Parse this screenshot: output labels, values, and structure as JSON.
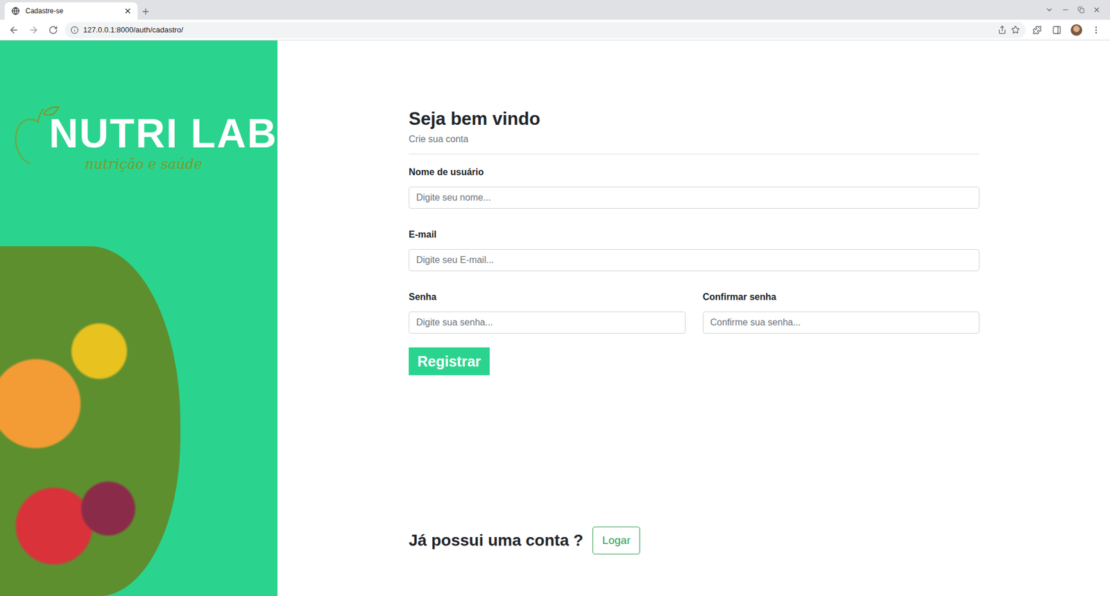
{
  "browser": {
    "tabs": [
      {
        "label": "Cadastre-se",
        "selected": true
      }
    ],
    "url": "127.0.0.1:8000/auth/cadastro/"
  },
  "logo": {
    "title": "NUTRI LAB",
    "tagline": "nutrição e saúde"
  },
  "form": {
    "heading": "Seja bem vindo",
    "subheading": "Crie sua conta",
    "fields": [
      {
        "label": "Nome de usuário",
        "placeholder": "Digite seu nome..."
      },
      {
        "label": "E-mail",
        "placeholder": "Digite seu E-mail..."
      }
    ],
    "password_fields": [
      {
        "label": "Senha",
        "placeholder": "Digite sua senha..."
      },
      {
        "label": "Confirmar senha",
        "placeholder": "Confirme sua senha..."
      }
    ],
    "submit": "Registrar"
  },
  "footer": {
    "question": "Já possui uma conta ?",
    "button": "Logar"
  }
}
